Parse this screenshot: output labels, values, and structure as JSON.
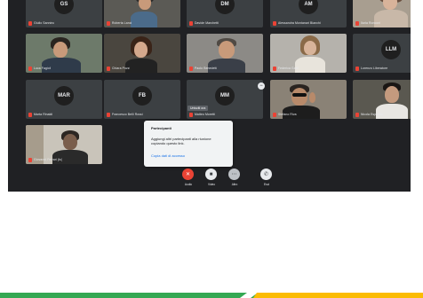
{
  "tiles": [
    {
      "initials": "GS",
      "name": "Giulio Sannino"
    },
    {
      "initials": "",
      "name": "Roberta Lanci"
    },
    {
      "initials": "DM",
      "name": "Davide Marchetti"
    },
    {
      "initials": "AM",
      "name": "Alessandra Montanari Bianchi"
    },
    {
      "initials": "",
      "name": "Ilaria Ronconi"
    },
    {
      "initials": "",
      "name": "Luca Fagioli"
    },
    {
      "initials": "",
      "name": "Chiara Pozzi"
    },
    {
      "initials": "",
      "name": "Paolo Benedetti"
    },
    {
      "initials": "",
      "name": "Federica Gatti"
    },
    {
      "initials": "LLM",
      "name": "Lorenzo Liberatore"
    },
    {
      "initials": "MAR",
      "name": "Marta Rinaldi"
    },
    {
      "initials": "FB",
      "name": "Francesco Belli Rossi"
    },
    {
      "initials": "MM",
      "name": "Matteo Moretti"
    },
    {
      "initials": "",
      "name": "Stefano Riva"
    },
    {
      "initials": "",
      "name": "Nicola Esposito"
    },
    {
      "initials": "",
      "name": "Giovanni Ferrari (tu)"
    }
  ],
  "tooltip": "Unisciti ora",
  "popover": {
    "title": "Partecipanti",
    "body": "Aggiungi altri partecipanti alla riunione copiando questo link.",
    "link": "Copia dati di accesso"
  },
  "toolbar": [
    {
      "label": "Audio",
      "glyph": "✕",
      "color": "#ea4335"
    },
    {
      "label": "Video",
      "glyph": "■",
      "color": "#ffffff"
    },
    {
      "label": "Altro",
      "glyph": "⋯",
      "color": "#ffffff"
    },
    {
      "label": "Esci",
      "glyph": "✆",
      "color": "#ffffff"
    }
  ]
}
